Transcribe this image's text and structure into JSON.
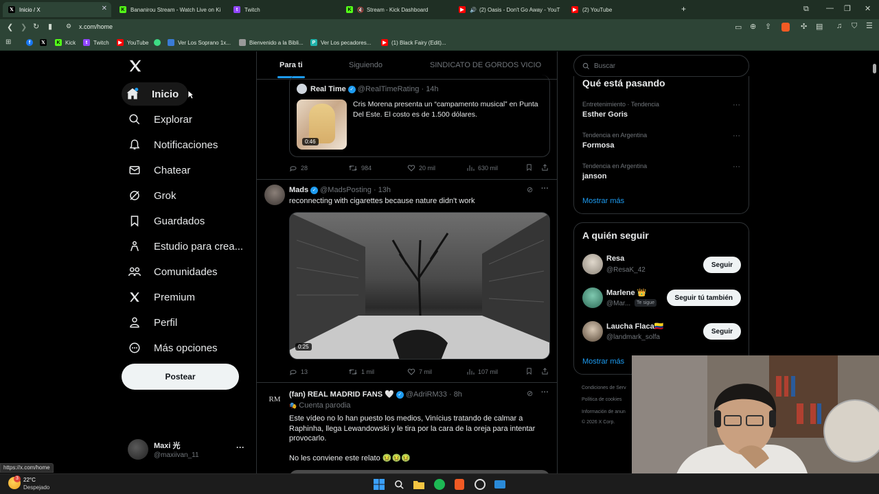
{
  "browser": {
    "tabs": [
      {
        "title": "Inicio / X",
        "icon": "x-logo",
        "color": "#000000"
      },
      {
        "title": "Bananirou Stream - Watch Live on Ki",
        "icon": "kick-logo",
        "color": "#53fc18"
      },
      {
        "title": "Twitch",
        "icon": "twitch-logo",
        "color": "#9146ff"
      },
      {
        "title": "Stream - Kick Dashboard",
        "icon": "kick-logo",
        "color": "#53fc18"
      },
      {
        "title": "(2) Oasis - Don't Go Away - YouT",
        "icon": "youtube-logo",
        "color": "#ff0000"
      },
      {
        "title": "(2) YouTube",
        "icon": "youtube-logo",
        "color": "#ff0000"
      }
    ],
    "new_tab_label": "+",
    "url": "x.com/home",
    "bookmarks": [
      {
        "label": "",
        "icon": "facebook-logo",
        "color": "#1877f2"
      },
      {
        "label": "",
        "icon": "x-logo",
        "color": "#000000"
      },
      {
        "label": "Kick",
        "icon": "kick-logo",
        "color": "#53fc18"
      },
      {
        "label": "Twitch",
        "icon": "twitch-logo",
        "color": "#9146ff"
      },
      {
        "label": "YouTube",
        "icon": "youtube-logo",
        "color": "#ff0000"
      },
      {
        "label": "",
        "icon": "android-logo",
        "color": "#3ddc84"
      },
      {
        "label": "Ver Los Soprano 1x...",
        "icon": "page-icon",
        "color": "#3a7bd5"
      },
      {
        "label": "Bienvenido a la Bibli...",
        "icon": "page-icon",
        "color": "#999999"
      },
      {
        "label": "Ver Los pecadores...",
        "icon": "page-icon",
        "color": "#20b2aa"
      },
      {
        "label": "(1) Black Fairy (Edit)...",
        "icon": "youtube-logo",
        "color": "#ff0000"
      }
    ],
    "status_url": "https://x.com/home"
  },
  "sidebar": {
    "items": [
      {
        "label": "Inicio",
        "icon": "home-icon"
      },
      {
        "label": "Explorar",
        "icon": "search-icon"
      },
      {
        "label": "Notificaciones",
        "icon": "bell-icon"
      },
      {
        "label": "Chatear",
        "icon": "mail-icon"
      },
      {
        "label": "Grok",
        "icon": "grok-icon"
      },
      {
        "label": "Guardados",
        "icon": "bookmark-icon"
      },
      {
        "label": "Estudio para crea...",
        "icon": "person-icon"
      },
      {
        "label": "Comunidades",
        "icon": "people-icon"
      },
      {
        "label": "Premium",
        "icon": "x-logo-icon"
      },
      {
        "label": "Perfil",
        "icon": "profile-icon"
      },
      {
        "label": "Más opciones",
        "icon": "more-circle-icon"
      }
    ],
    "post_label": "Postear",
    "account": {
      "name": "Maxi 光",
      "handle": "@maxiivan_11",
      "more": "···"
    }
  },
  "feed": {
    "tabs": [
      "Para ti",
      "Siguiendo",
      "SINDICATO DE GORDOS VICIO"
    ],
    "quoted": {
      "name": "Real Time",
      "handle": "@RealTimeRating",
      "time": "14h",
      "text": "Cris Morena presenta un “campamento musical” en Punta Del Este. El costo es de 1.500 dólares.",
      "duration": "0:46"
    },
    "post1_actions": {
      "replies": "28",
      "reposts": "984",
      "likes": "20 mil",
      "views": "630 mil"
    },
    "post2": {
      "name": "Mads",
      "handle": "@MadsPosting",
      "time": "13h",
      "text": "reconnecting with cigarettes because nature didn't work",
      "duration": "0:25",
      "actions": {
        "replies": "13",
        "reposts": "1 mil",
        "likes": "7 mil",
        "views": "107 mil"
      }
    },
    "post3": {
      "name": "(fan) REAL MADRID FANS 🤍",
      "handle": "@AdriRM33",
      "time": "8h",
      "badge": "Cuenta parodia",
      "avatar_text": "RM",
      "text": "Este vídeo no lo han puesto los medios, Vinícius tratando de calmar a Raphinha, llega Lewandowski y le tira por la cara de la oreja para intentar provocarlo.",
      "text2": "No les conviene este relato 🤢🤢🤢"
    },
    "separator": "·"
  },
  "right": {
    "search_placeholder": "Buscar",
    "trends_title": "Qué está pasando",
    "trends": [
      {
        "meta": "Entretenimiento · Tendencia",
        "name": "Esther Goris"
      },
      {
        "meta": "Tendencia en Argentina",
        "name": "Formosa"
      },
      {
        "meta": "Tendencia en Argentina",
        "name": "janson"
      }
    ],
    "show_more": "Mostrar más",
    "follow_title": "A quién seguir",
    "follow": [
      {
        "name": "Resa",
        "handle": "@ResaK_42",
        "button": "Seguir",
        "badge": ""
      },
      {
        "name": "Marlene 👑",
        "handle": "@Mar...",
        "button": "Seguir tú también",
        "badge": "Te sigue"
      },
      {
        "name": "Laucha Flaca🇨🇴",
        "handle": "@landmark_solfa",
        "button": "Seguir",
        "badge": ""
      }
    ],
    "show_more2": "Mostrar más",
    "footer": [
      "Condiciones de Serv",
      "Política de cookies",
      "Información de anun",
      "© 2026 X Corp."
    ]
  },
  "taskbar": {
    "temp": "22°C",
    "weather": "Despejado",
    "badge": "3"
  }
}
